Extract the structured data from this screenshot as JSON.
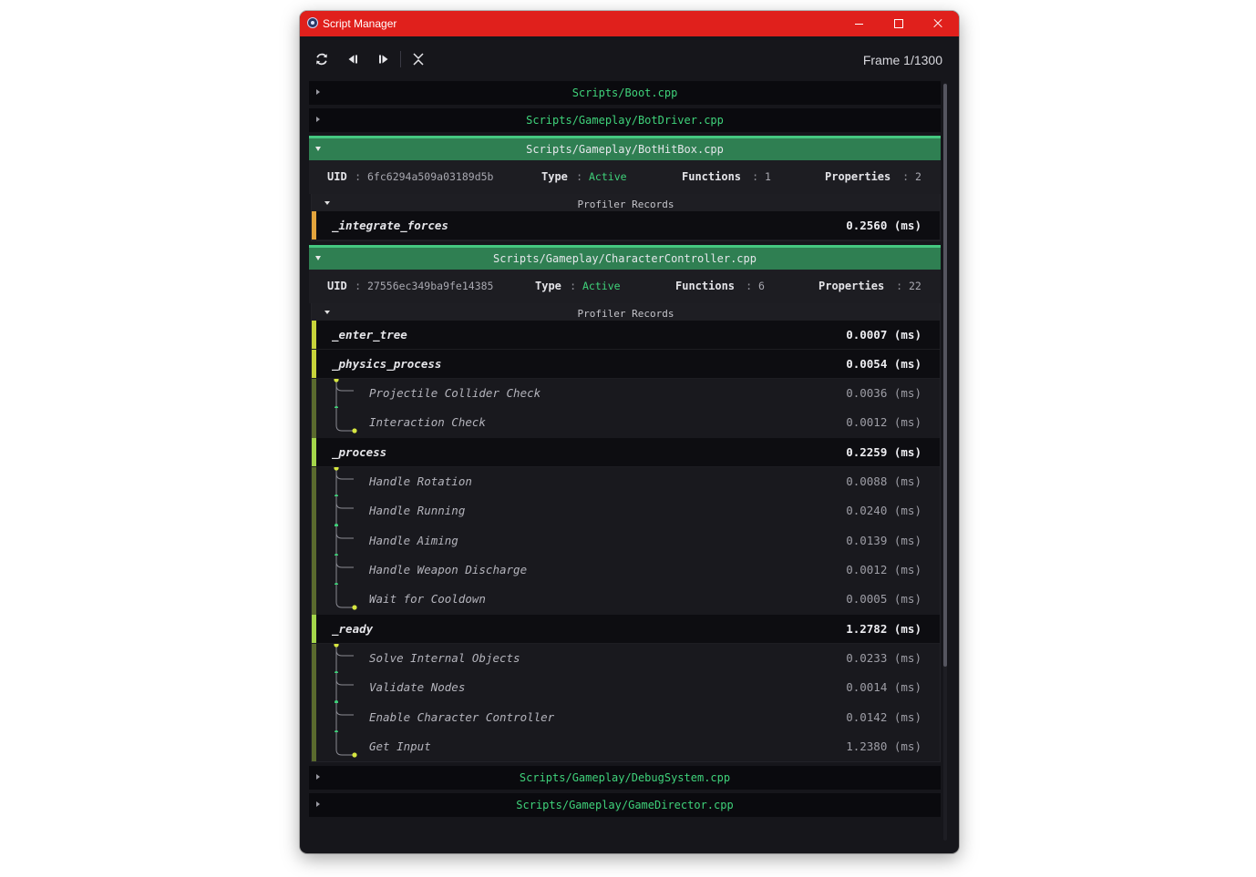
{
  "window": {
    "title": "Script Manager",
    "icon": "app-logo-icon",
    "controls": [
      "minimize-icon",
      "maximize-icon",
      "close-icon"
    ],
    "accent_color": "#e0201c"
  },
  "toolbar": {
    "buttons": [
      "refresh-icon",
      "step-back-icon",
      "step-forward-icon",
      "collapse-all-icon"
    ],
    "frame_label": "Frame 1/1300"
  },
  "labels": {
    "uid": "UID",
    "type": "Type",
    "functions": "Functions",
    "properties": "Properties",
    "colon": ":",
    "profiler_records": "Profiler Records"
  },
  "colors": {
    "path_green": "#3fd27a",
    "open_header": "#2f7f52",
    "bar_orange": "#e3a43c",
    "bar_yellow": "#c8d43a",
    "bar_lime": "#a4d64a"
  },
  "scripts": [
    {
      "path": "Scripts/Boot.cpp",
      "expanded": false
    },
    {
      "path": "Scripts/Gameplay/BotDriver.cpp",
      "expanded": false
    },
    {
      "path": "Scripts/Gameplay/BotHitBox.cpp",
      "expanded": true,
      "uid": "6fc6294a509a03189d5b",
      "type": "Active",
      "functions": "1",
      "properties": "2",
      "records": [
        {
          "name": "_integrate_forces",
          "time": "0.2560 (ms)",
          "bar": "orange",
          "children": []
        }
      ]
    },
    {
      "path": "Scripts/Gameplay/CharacterController.cpp",
      "expanded": true,
      "uid": "27556ec349ba9fe14385",
      "type": "Active",
      "functions": "6",
      "properties": "22",
      "records": [
        {
          "name": "_enter_tree",
          "time": "0.0007 (ms)",
          "bar": "yellow",
          "children": []
        },
        {
          "name": "_physics_process",
          "time": "0.0054 (ms)",
          "bar": "yellow",
          "children": [
            {
              "name": "Projectile Collider Check",
              "time": "0.0036 (ms)"
            },
            {
              "name": "Interaction Check",
              "time": "0.0012 (ms)"
            }
          ]
        },
        {
          "name": "_process",
          "time": "0.2259 (ms)",
          "bar": "lime",
          "children": [
            {
              "name": "Handle Rotation",
              "time": "0.0088 (ms)"
            },
            {
              "name": "Handle Running",
              "time": "0.0240 (ms)"
            },
            {
              "name": "Handle Aiming",
              "time": "0.0139 (ms)"
            },
            {
              "name": "Handle Weapon Discharge",
              "time": "0.0012 (ms)"
            },
            {
              "name": "Wait for Cooldown",
              "time": "0.0005 (ms)"
            }
          ]
        },
        {
          "name": "_ready",
          "time": "1.2782 (ms)",
          "bar": "lime",
          "children": [
            {
              "name": "Solve Internal Objects",
              "time": "0.0233 (ms)"
            },
            {
              "name": "Validate Nodes",
              "time": "0.0014 (ms)"
            },
            {
              "name": "Enable Character Controller",
              "time": "0.0142 (ms)"
            },
            {
              "name": "Get Input",
              "time": "1.2380 (ms)"
            }
          ]
        }
      ]
    },
    {
      "path": "Scripts/Gameplay/DebugSystem.cpp",
      "expanded": false
    },
    {
      "path": "Scripts/Gameplay/GameDirector.cpp",
      "expanded": false
    }
  ]
}
